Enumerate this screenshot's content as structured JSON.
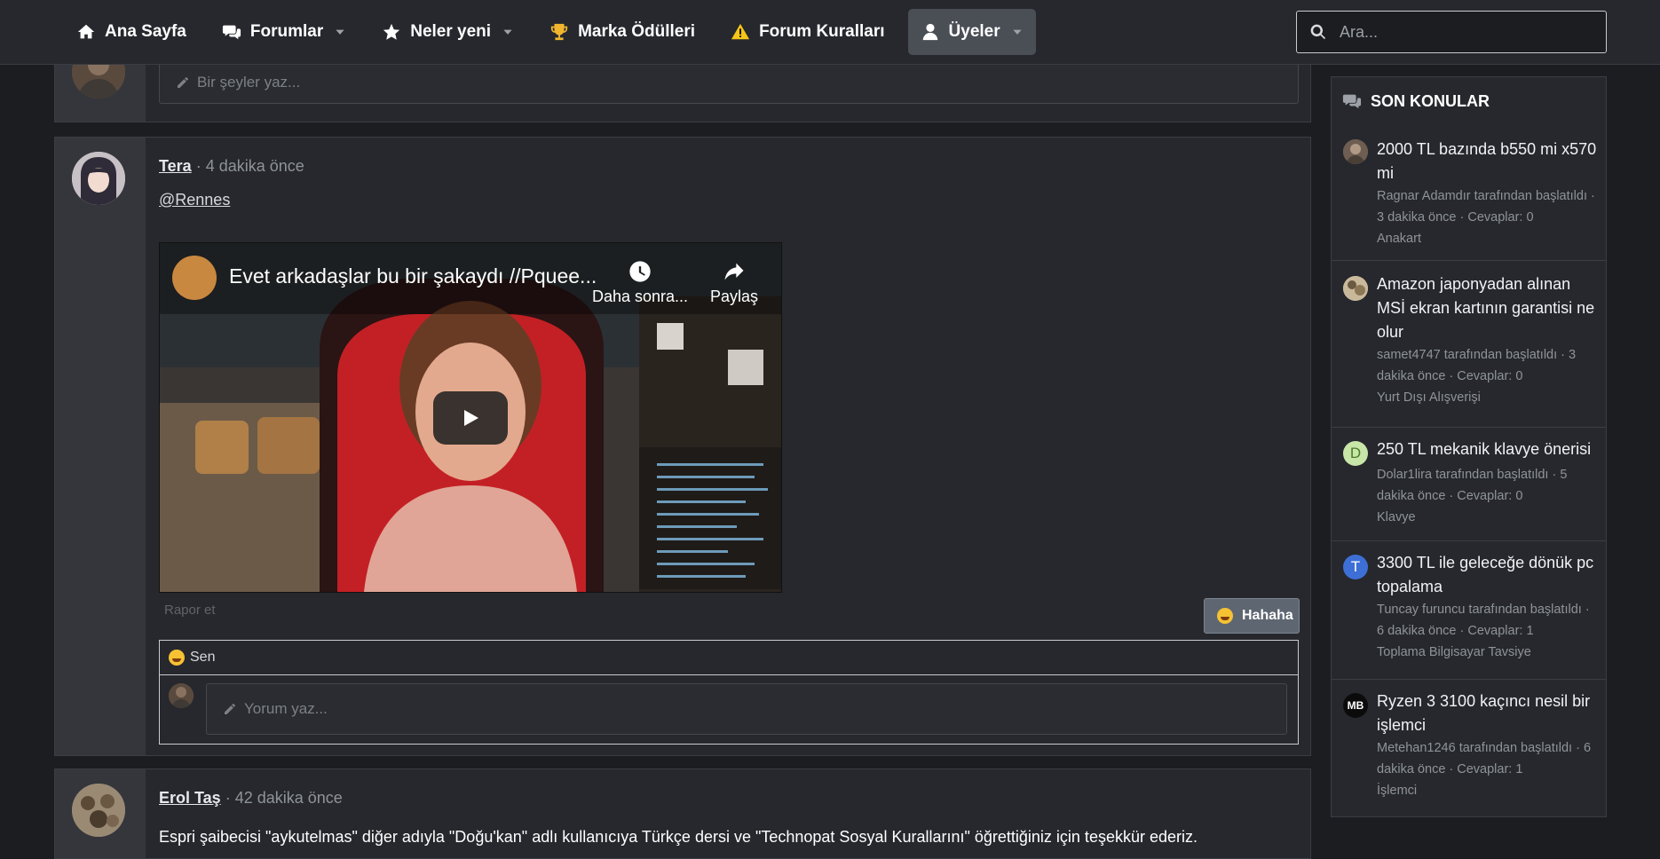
{
  "nav": {
    "items": [
      {
        "label": "Ana Sayfa",
        "icon": "home-icon",
        "has_caret": false
      },
      {
        "label": "Forumlar",
        "icon": "comments-icon",
        "has_caret": true
      },
      {
        "label": "Neler yeni",
        "icon": "star-icon",
        "has_caret": true
      },
      {
        "label": "Marka Ödülleri",
        "icon": "trophy-icon",
        "has_caret": false
      },
      {
        "label": "Forum Kuralları",
        "icon": "warning-icon",
        "has_caret": false
      },
      {
        "label": "Üyeler",
        "icon": "user-icon",
        "has_caret": true,
        "active": true
      }
    ],
    "search_placeholder": "Ara..."
  },
  "top_comment_placeholder": "Bir şeyler yaz...",
  "posts": [
    {
      "user": "Tera",
      "time": "· 4 dakika önce",
      "mention": "@Rennes",
      "video": {
        "title": "Evet arkadaşlar bu bir şakaydı //Pquee...",
        "watch_later": "Daha sonra...",
        "share": "Paylaş"
      },
      "report": "Rapor et",
      "reaction_button": "Hahaha",
      "reacted_by": "Sen",
      "comment_placeholder": "Yorum yaz..."
    },
    {
      "user": "Erol Taş",
      "time": "· 42 dakika önce",
      "text": "Espri şaibecisi \"aykutelmas\" diğer adıyla \"Doğu'kan\" adlı kullanıcıya Türkçe dersi ve \"Technopat Sosyal Kurallarını\" öğrettiğiniz için teşekkür ederiz."
    }
  ],
  "sidebar": {
    "title": "SON KONULAR",
    "topics": [
      {
        "title": "2000 TL bazında b550 mi x570 mi",
        "meta": "Ragnar Adamdır tarafından başlatıldı · 3 dakika önce · Cevaplar: 0",
        "forum": "Anakart",
        "avatar_letter": "",
        "avatar_color": "#7a6a5e"
      },
      {
        "title": "Amazon japonyadan alınan MSİ ekran kartının garantisi ne olur",
        "meta": "samet4747 tarafından başlatıldı · 3 dakika önce · Cevaplar: 0",
        "forum": "Yurt Dışı Alışverişi",
        "avatar_letter": "",
        "avatar_color": "#b8a98a"
      },
      {
        "title": "250 TL mekanik klavye önerisi",
        "meta": "Dolar1lira tarafından başlatıldı · 5 dakika önce · Cevaplar: 0",
        "forum": "Klavye",
        "avatar_letter": "D",
        "avatar_color": "#c8e6a8"
      },
      {
        "title": "3300 TL ile geleceğe dönük pc topalama",
        "meta": "Tuncay furuncu tarafından başlatıldı · 6 dakika önce · Cevaplar: 1",
        "forum": "Toplama Bilgisayar Tavsiye",
        "avatar_letter": "T",
        "avatar_color": "#3d6fd6"
      },
      {
        "title": "Ryzen 3 3100 kaçıncı nesil bir işlemci",
        "meta": "Metehan1246 tarafından başlatıldı · 6 dakika önce · Cevaplar: 1",
        "forum": "İşlemci",
        "avatar_letter": "MB",
        "avatar_color": "#0b0b0b"
      }
    ]
  }
}
